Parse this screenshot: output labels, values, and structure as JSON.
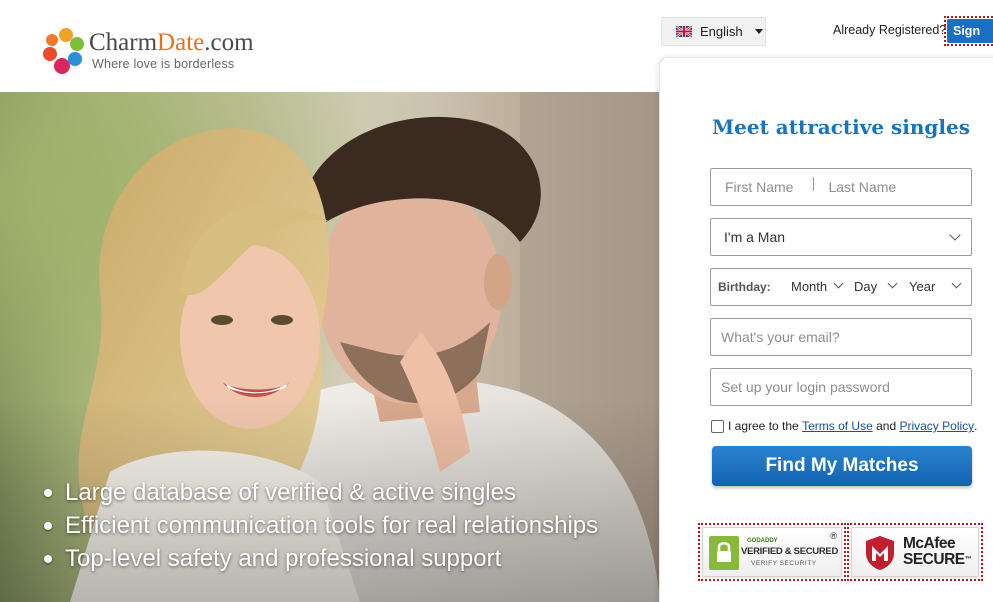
{
  "brand": {
    "name_part1": "Charm",
    "name_part2": "Date",
    "name_part3": ".com",
    "tagline": "Where love is borderless",
    "accent_color": "#e8711d"
  },
  "header": {
    "language": {
      "label": "English",
      "icon": "uk-flag-icon"
    },
    "already_registered": "Already Registered?",
    "sign_in_label": "Sign"
  },
  "hero": {
    "bullets": [
      "Large database of verified & active singles",
      "Efficient communication tools for real relationships",
      "Top-level safety and professional support"
    ]
  },
  "form": {
    "title": "Meet attractive singles",
    "first_name_placeholder": "First Name",
    "last_name_placeholder": "Last Name",
    "gender_value": "I'm a Man",
    "birthday_label": "Birthday:",
    "birthday_month": "Month",
    "birthday_day": "Day",
    "birthday_year": "Year",
    "email_placeholder": "What's your email?",
    "password_placeholder": "Set up your login password",
    "agree_prefix": "I agree to the",
    "terms_label": "Terms of Use",
    "and_text": "and",
    "privacy_label": "Privacy Policy",
    "period": ".",
    "submit_label": "Find My Matches",
    "primary_color": "#1b74b7"
  },
  "badges": {
    "godaddy_small": "GODADDY",
    "godaddy_main": "VERIFIED & SECURED",
    "godaddy_sub": "VERIFY SECURITY",
    "godaddy_reg": "®",
    "mcafee_line1": "McAfee",
    "mcafee_line2": "SECURE",
    "mcafee_tm": "™"
  }
}
